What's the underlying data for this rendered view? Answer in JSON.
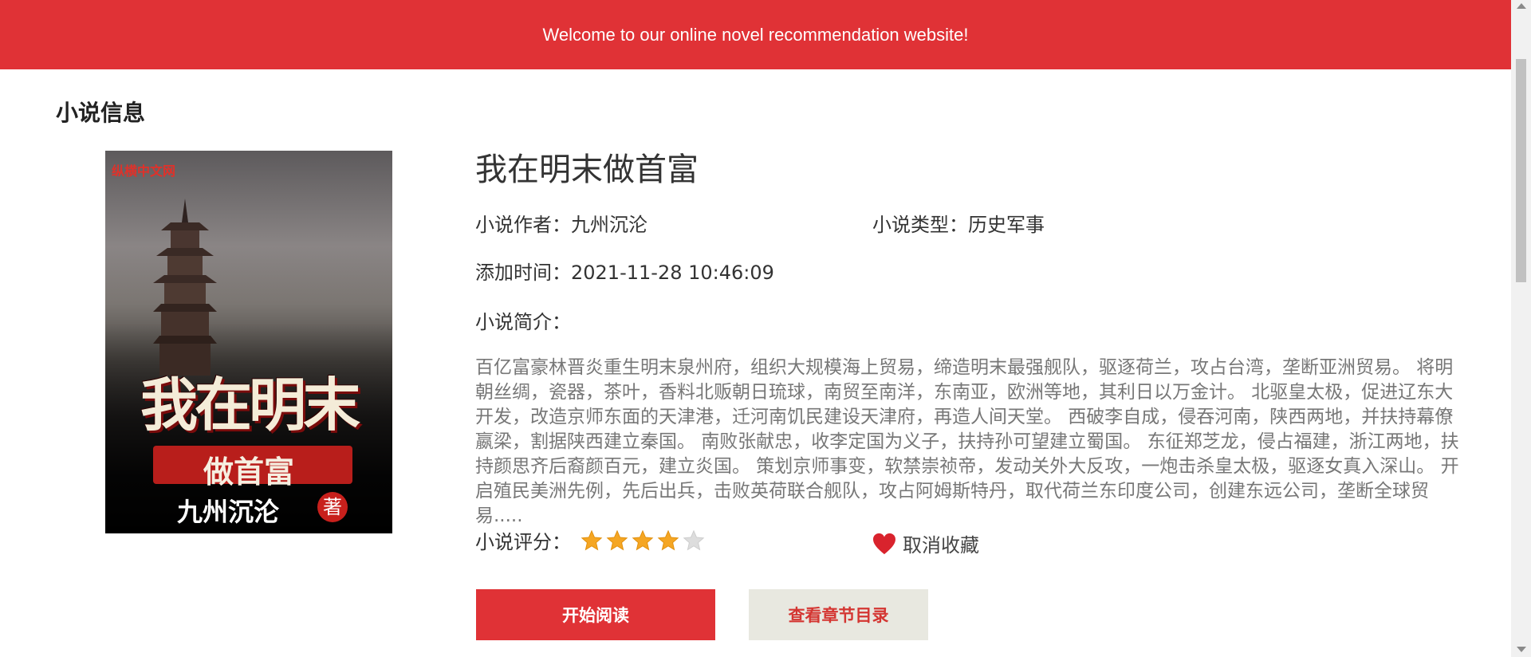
{
  "header": {
    "welcome_text": "Welcome to our online novel recommendation website!"
  },
  "section": {
    "title": "小说信息"
  },
  "cover": {
    "logo_text": "纵横中文网",
    "title_text": "我在明末",
    "subtitle_text": "做首富",
    "author_text": "九州沉沦",
    "author_mark": "著"
  },
  "novel": {
    "title": "我在明末做首富",
    "author_label": "小说作者：",
    "author": "九州沉沦",
    "type_label": "小说类型：",
    "type": "历史军事",
    "added_label": "添加时间：",
    "added_time": "2021-11-28 10:46:09",
    "synopsis_label": "小说简介：",
    "synopsis": "百亿富豪林晋炎重生明末泉州府，组织大规模海上贸易，缔造明末最强舰队，驱逐荷兰，攻占台湾，垄断亚洲贸易。 将明朝丝绸，瓷器，茶叶，香料北贩朝日琉球，南贸至南洋，东南亚，欧洲等地，其利日以万金计。 北驱皇太极，促进辽东大开发，改造京师东面的天津港，迁河南饥民建设天津府，再造人间天堂。 西破李自成，侵吞河南，陕西两地，并扶持幕僚嬴梁，割据陕西建立秦国。 南败张献忠，收李定国为义子，扶持孙可望建立蜀国。 东征郑芝龙，侵占福建，浙江两地，扶持颜思齐后裔颜百元，建立炎国。 策划京师事变，软禁崇祯帝，发动关外大反攻，一炮击杀皇太极，驱逐女真入深山。 开启殖民美洲先例，先后出兵，击败英荷联合舰队，攻占阿姆斯特丹，取代荷兰东印度公司，创建东远公司，垄断全球贸易.....",
    "rating_label": "小说评分：",
    "rating": 4,
    "rating_max": 5
  },
  "actions": {
    "favorite_label": "取消收藏",
    "read_label": "开始阅读",
    "toc_label": "查看章节目录"
  },
  "colors": {
    "accent": "#e03236",
    "star": "#f5a623",
    "star_empty": "#dddddd"
  }
}
